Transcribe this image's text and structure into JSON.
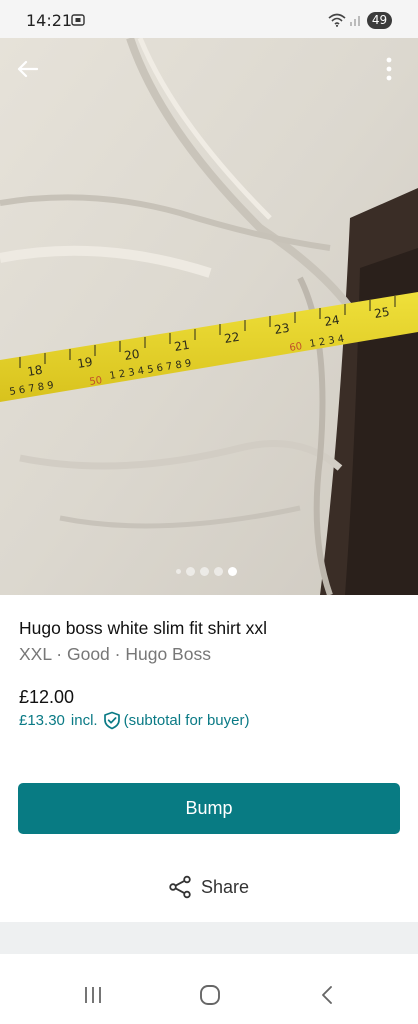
{
  "status_bar": {
    "time": "14:21",
    "battery": "49",
    "icons": [
      "screenshot-icon",
      "wifi-icon",
      "signal-icon"
    ]
  },
  "gallery": {
    "image_count": 5,
    "active_index": 4,
    "icons": [
      "back-arrow-icon",
      "more-vert-icon"
    ]
  },
  "item": {
    "title": "Hugo boss white slim fit shirt xxl",
    "details": "XXL · Good · Hugo Boss",
    "price": "£12.00",
    "price_incl": "£13.30",
    "incl_label": "incl.",
    "buyer_note": "(subtotal for buyer)"
  },
  "actions": {
    "bump_label": "Bump",
    "share_label": "Share"
  },
  "system_nav": {
    "icons": [
      "recent-apps-icon",
      "home-icon",
      "back-icon"
    ]
  },
  "colors": {
    "accent": "#087b83",
    "accent_text": "#0a7a85"
  }
}
